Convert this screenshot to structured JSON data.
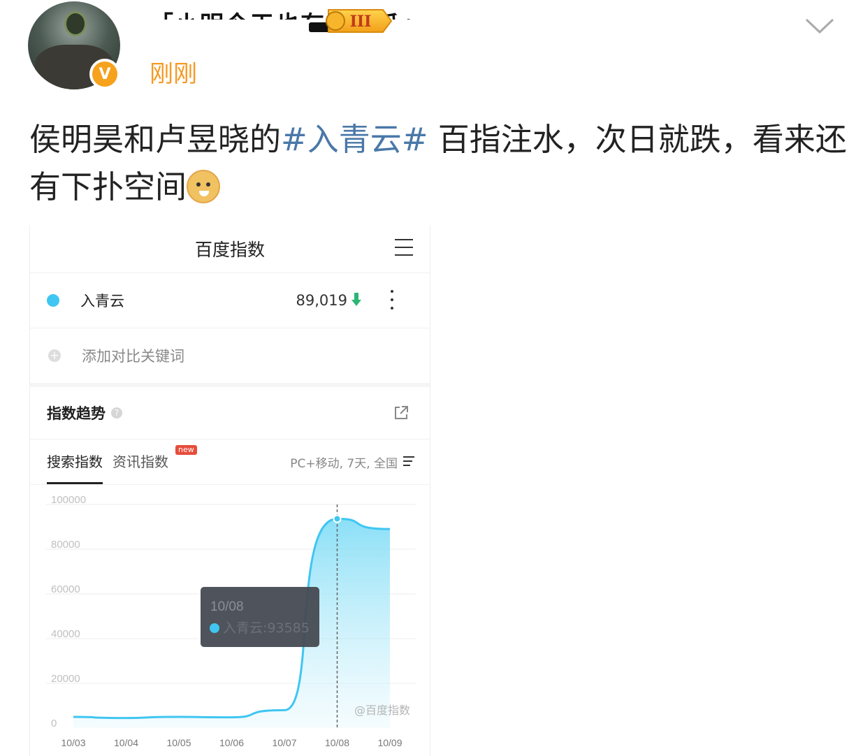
{
  "post": {
    "username": "「小明今天也有在吃瓜」",
    "rank_badge": "III",
    "timestamp": "刚刚",
    "text_before": "侯明昊和卢昱晓的",
    "hashtag": "#入青云#",
    "text_after": " 百指注水，次日就跌，看来还有下扑空间",
    "emoji_icon": "doge-emoji-icon",
    "verified_icon": "verified-v-icon"
  },
  "card": {
    "title": "百度指数",
    "keyword": {
      "name": "入青云",
      "value": "89,019",
      "trend": "down",
      "color": "#3fc6f2"
    },
    "add_keyword": "添加对比关键词",
    "trend_title": "指数趋势",
    "tabs": [
      {
        "label": "搜索指数",
        "active": true
      },
      {
        "label": "资讯指数",
        "active": false
      }
    ],
    "new_badge": "new",
    "filters": "PC+移动, 7天, 全国"
  },
  "chart_data": {
    "type": "area",
    "x": [
      "10/03",
      "10/04",
      "10/05",
      "10/06",
      "10/07",
      "10/08",
      "10/09"
    ],
    "series": [
      {
        "name": "入青云",
        "values": [
          5000,
          4500,
          5000,
          4800,
          8000,
          93585,
          89019
        ],
        "color": "#3fc6f2"
      }
    ],
    "yticks": [
      "100000",
      "80000",
      "60000",
      "40000",
      "20000",
      "0"
    ],
    "ylim": [
      0,
      100000
    ],
    "tooltip": {
      "date": "10/08",
      "label": "入青云:93585"
    },
    "watermark": "@百度指数",
    "grid": true
  }
}
